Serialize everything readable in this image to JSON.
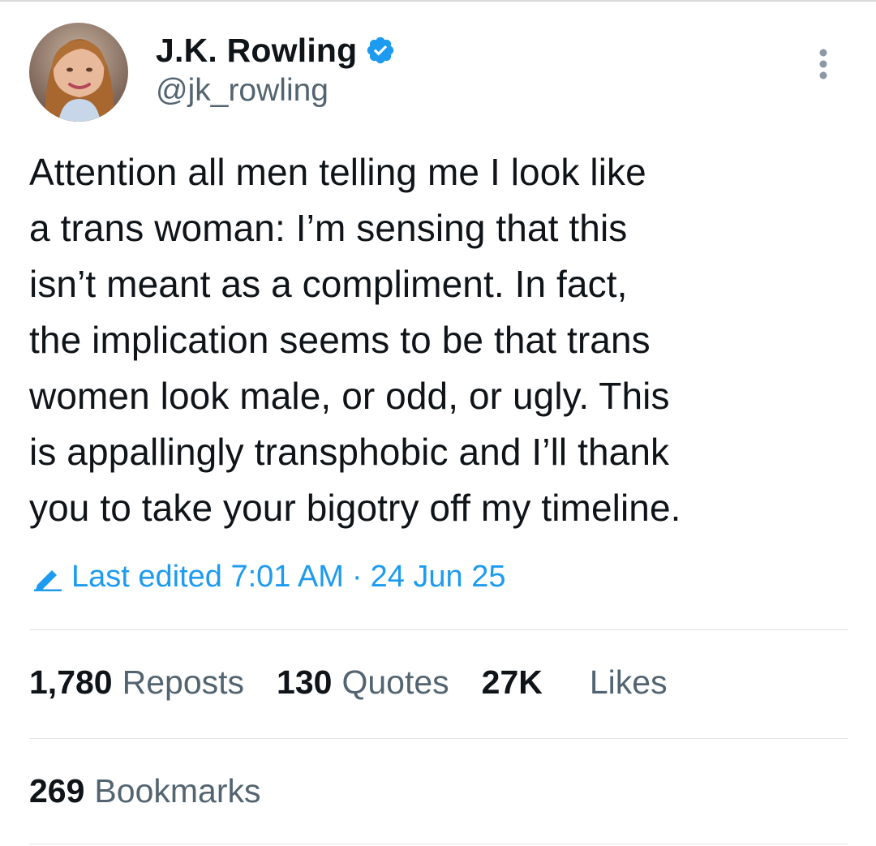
{
  "author": {
    "display_name": "J.K. Rowling",
    "handle": "@jk_rowling",
    "verified": true,
    "verified_icon": "verified-badge-icon",
    "avatar_icon": "profile-photo"
  },
  "tweet": {
    "text": "Attention all men telling me I look like\na trans woman: I’m sensing that this\nisn’t meant as a compliment. In fact,\nthe implication seems to be that trans\nwomen look male, or odd, or ugly. This\nis appallingly transphobic and I’ll thank\nyou to take your bigotry off my timeline.",
    "edited_label": "Last edited 7:01 AM",
    "separator": "·",
    "date": "24 Jun 25"
  },
  "stats": {
    "reposts": {
      "count": "1,780",
      "label": "Reposts"
    },
    "quotes": {
      "count": "130",
      "label": "Quotes"
    },
    "likes": {
      "count": "27K",
      "label": "Likes"
    },
    "bookmarks": {
      "count": "269",
      "label": "Bookmarks"
    }
  },
  "colors": {
    "accent": "#1d9bf0",
    "text_primary": "#0f1419",
    "text_secondary": "#536471",
    "divider": "#e1e4e8"
  }
}
